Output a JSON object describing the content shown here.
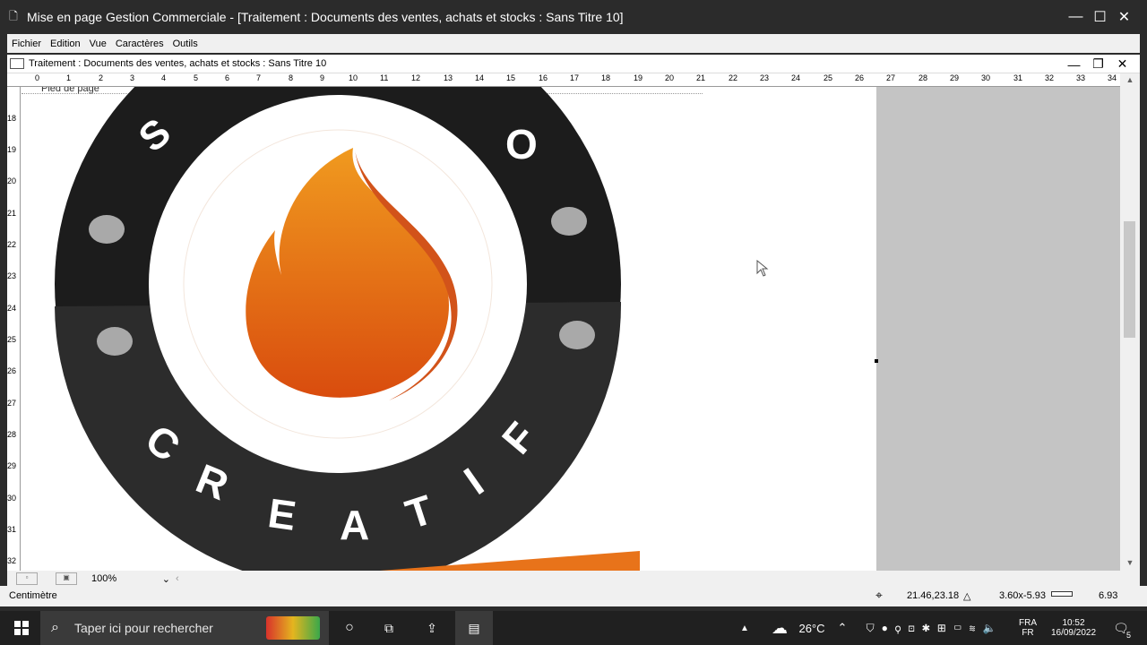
{
  "app": {
    "title": "Mise en page Gestion Commerciale - [Traitement : Documents des ventes, achats et stocks : Sans Titre 10]",
    "window_controls": [
      "—",
      "☐",
      "✕"
    ]
  },
  "menu": [
    "Fichier",
    "Edition",
    "Vue",
    "Caractères",
    "Outils"
  ],
  "document": {
    "title": "Traitement : Documents des ventes, achats et stocks : Sans Titre 10",
    "footer_label": "Pied de page",
    "ruler_h": [
      "0",
      "1",
      "2",
      "3",
      "4",
      "5",
      "6",
      "7",
      "8",
      "9",
      "10",
      "11",
      "12",
      "13",
      "14",
      "15",
      "16",
      "17",
      "18",
      "19",
      "20",
      "21",
      "22",
      "23",
      "24",
      "25",
      "26",
      "27",
      "28",
      "29",
      "30",
      "31",
      "32",
      "33",
      "34"
    ],
    "ruler_v": [
      "18",
      "19",
      "20",
      "21",
      "22",
      "23",
      "24",
      "25",
      "26",
      "27",
      "28",
      "29",
      "30",
      "31",
      "32"
    ]
  },
  "logo": {
    "ring_color": "#1a1a1a",
    "flame_color": "#e8731a",
    "text_top": [
      "S",
      "O"
    ],
    "text_bottom": [
      "C",
      "R",
      "E",
      "A",
      "T",
      "I",
      "F"
    ]
  },
  "bottom_bar": {
    "zoom": "100%"
  },
  "status": {
    "unit": "Centimètre",
    "position": "21.46,23.18",
    "size": "3.60x-5.93",
    "value": "6.93"
  },
  "taskbar": {
    "search_placeholder": "Taper ici pour rechercher",
    "weather": "26°C",
    "lang_top": "FRA",
    "lang_bottom": "FR",
    "time": "10:52",
    "date": "16/09/2022",
    "notifications": "5"
  }
}
